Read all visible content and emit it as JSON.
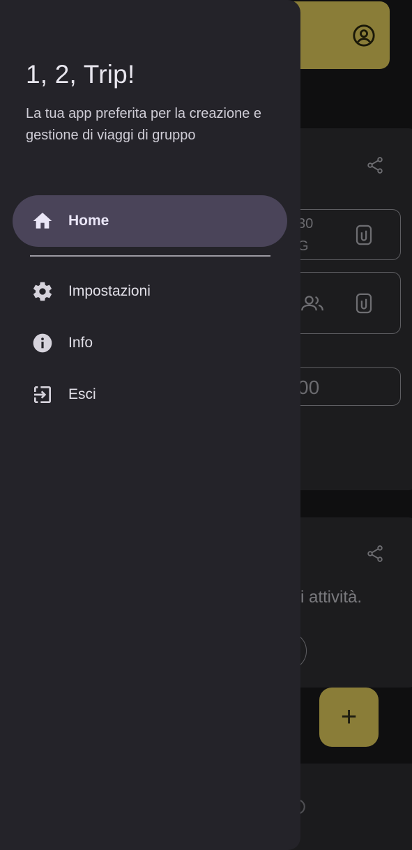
{
  "background": {
    "text_line_1": "30",
    "text_line_2": "G",
    "amount_text": "00",
    "activities_text": "i attività.",
    "fab_symbol": "+",
    "icons": [
      "account-circle-icon",
      "share-icon",
      "paperclip-icon",
      "group-icon",
      "add-icon"
    ]
  },
  "drawer": {
    "title": "1, 2, Trip!",
    "subtitle": "La tua app preferita per la creazione e gestione di viaggi di gruppo",
    "items": [
      {
        "label": "Home",
        "icon": "home-icon",
        "active": true
      },
      {
        "label": "Impostazioni",
        "icon": "gear-icon",
        "active": false
      },
      {
        "label": "Info",
        "icon": "info-icon",
        "active": false
      },
      {
        "label": "Esci",
        "icon": "logout-icon",
        "active": false
      }
    ]
  },
  "colors": {
    "drawer_bg": "#242329",
    "active_item_bg": "#4a4459",
    "accent": "#8a7d38",
    "text_primary": "#e8e6ee"
  }
}
